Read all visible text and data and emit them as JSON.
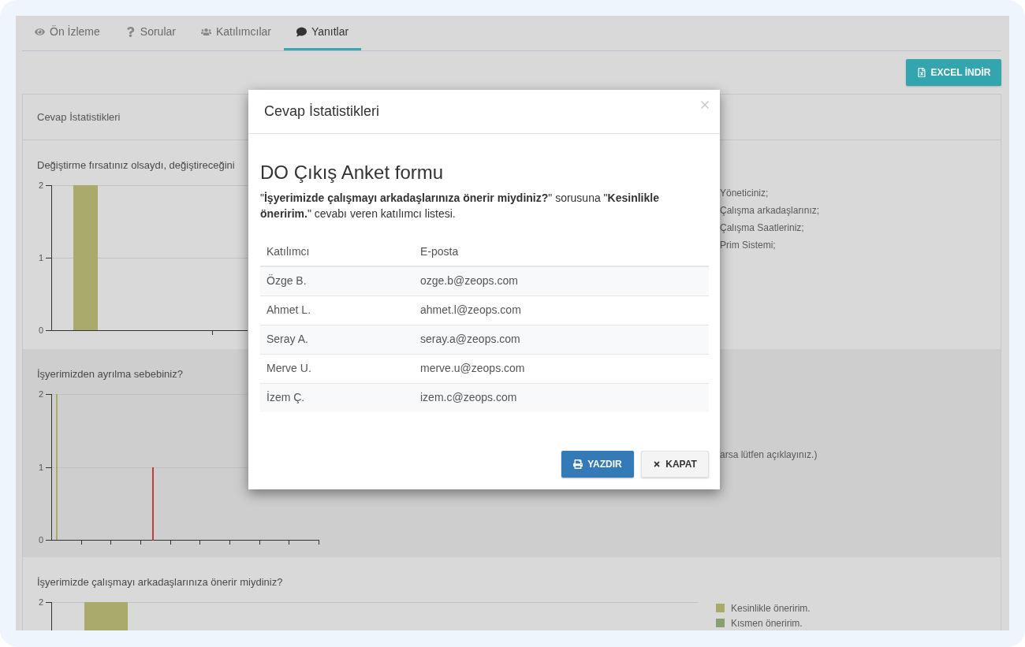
{
  "tabs": [
    {
      "label": "Ön İzleme",
      "selected": false
    },
    {
      "label": "Sorular",
      "selected": false
    },
    {
      "label": "Katılımcılar",
      "selected": false
    },
    {
      "label": "Yanıtlar",
      "selected": true
    }
  ],
  "excel_button": {
    "label": "EXCEL İNDİR"
  },
  "stats_card": {
    "title": "Cevap İstatistikleri",
    "sections": [
      {
        "question": "Değiştirme fırsatınız olsaydı, değiştireceğini",
        "chart_data": {
          "type": "bar",
          "ylim": [
            0,
            2
          ],
          "yticks": [
            0,
            1,
            2
          ],
          "series": [
            {
              "color": "#aaaa6b",
              "values": [
                2
              ]
            }
          ]
        },
        "legend": [
          {
            "label": "Yöneticiniz;"
          },
          {
            "label": "Çalışma arkadaşlarınız;"
          },
          {
            "label": "Çalışma Saatleriniz;"
          },
          {
            "label": "Prim Sistemi;"
          }
        ]
      },
      {
        "question": "İşyerimizden ayrılma sebebiniz?",
        "chart_data": {
          "type": "bar",
          "ylim": [
            0,
            2
          ],
          "yticks": [
            0,
            1,
            2
          ],
          "series": [
            {
              "color": "#aaaa6b",
              "values": [
                2,
                null,
                null,
                null,
                null,
                null,
                null,
                null,
                null
              ]
            },
            {
              "color": "#c23b3b",
              "values": [
                null,
                null,
                null,
                1,
                null,
                null,
                null,
                null,
                null
              ]
            }
          ]
        },
        "legend": [
          {
            "label": "arsa lütfen açıklayınız.)"
          }
        ]
      },
      {
        "question": "İşyerimizde çalışmayı arkadaşlarınıza önerir miydiniz?",
        "y_tick_labels": [
          "2"
        ],
        "legend": [
          {
            "label": "Kesinlikle öneririm.",
            "color": "#aaaa6b"
          },
          {
            "label": "Kısmen öneririm.",
            "color": "#889f70"
          }
        ]
      }
    ]
  },
  "modal": {
    "title": "Cevap İstatistikleri",
    "form_title": "DO Çıkış Anket formu",
    "description": "\"**İşyerimizde çalışmayı arkadaşlarınıza önerir miydiniz?**\" sorusuna \"**Kesinlikle öneririm.**\" cevabı veren katılımcı listesi.",
    "table": {
      "columns": [
        "Katılımcı",
        "E-posta"
      ],
      "rows": [
        [
          "Özge B.",
          "ozge.b@zeops.com"
        ],
        [
          "Ahmet L.",
          "ahmet.l@zeops.com"
        ],
        [
          "Seray A.",
          "seray.a@zeops.com"
        ],
        [
          "Merve U.",
          "merve.u@zeops.com"
        ],
        [
          "İzem Ç.",
          "izem.c@zeops.com"
        ]
      ]
    },
    "buttons": [
      {
        "label": "YAZDIR",
        "kind": "primary"
      },
      {
        "label": "KAPAT",
        "kind": "default"
      }
    ]
  }
}
